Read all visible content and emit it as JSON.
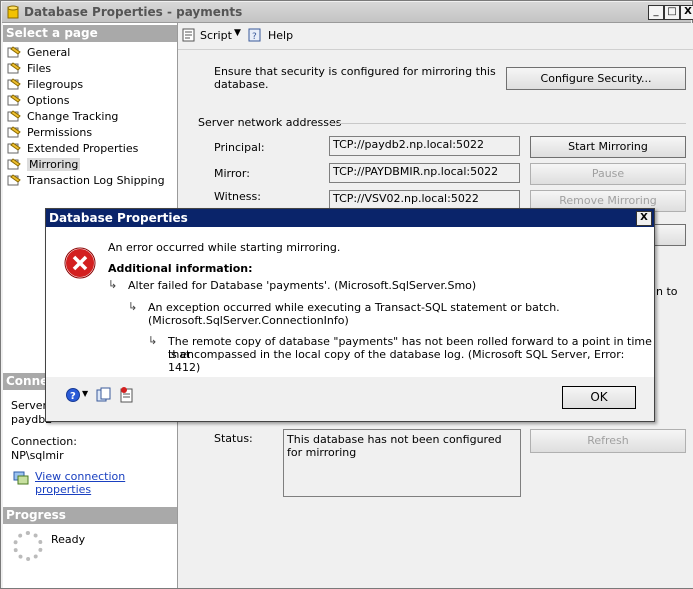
{
  "window": {
    "title": "Database Properties - payments",
    "min": "_",
    "max": "□",
    "close": "X"
  },
  "left": {
    "select_header": "Select a page",
    "pages": [
      "General",
      "Files",
      "Filegroups",
      "Options",
      "Change Tracking",
      "Permissions",
      "Extended Properties",
      "Mirroring",
      "Transaction Log Shipping"
    ],
    "selected_index": 7,
    "connection_header": "Conne",
    "server_label": "Server:",
    "server_value": "paydb2",
    "connection_label": "Connection:",
    "connection_value": "NP\\sqlmir",
    "view_conn_link": "View connection properties",
    "progress_header": "Progress",
    "progress_status": "Ready"
  },
  "toolbar": {
    "script": "Script",
    "help": "Help"
  },
  "mirroring": {
    "security_text_1": "Ensure that security is configured for mirroring this",
    "security_text_2": "database.",
    "configure_security": "Configure Security...",
    "network_group": "Server network addresses",
    "principal_label": "Principal:",
    "principal_value": "TCP://paydb2.np.local:5022",
    "mirror_label": "Mirror:",
    "mirror_value": "TCP://PAYDBMIR.np.local:5022",
    "witness_label": "Witness:",
    "witness_value": "TCP://VSV02.np.local:5022",
    "start_mirroring": "Start Mirroring",
    "pause": "Pause",
    "remove_mirroring": "Remove Mirroring",
    "partial_right_text": "n to",
    "status_label": "Status:",
    "status_text": "This database has not been configured for mirroring",
    "refresh": "Refresh"
  },
  "dialog": {
    "title": "Database Properties",
    "close": "X",
    "error_line": "An error occurred while starting mirroring.",
    "additional_info": "Additional information:",
    "lvl1": "Alter failed for Database 'payments'.  (Microsoft.SqlServer.Smo)",
    "lvl2a": "An exception occurred while executing a Transact-SQL statement or batch.",
    "lvl2b": "(Microsoft.SqlServer.ConnectionInfo)",
    "lvl3a": "The remote copy of database \"payments\" has not been rolled forward to a point in time that",
    "lvl3b": "is encompassed in the local copy of the database log. (Microsoft SQL Server, Error: 1412)",
    "ok": "OK",
    "arrow": "↳"
  }
}
